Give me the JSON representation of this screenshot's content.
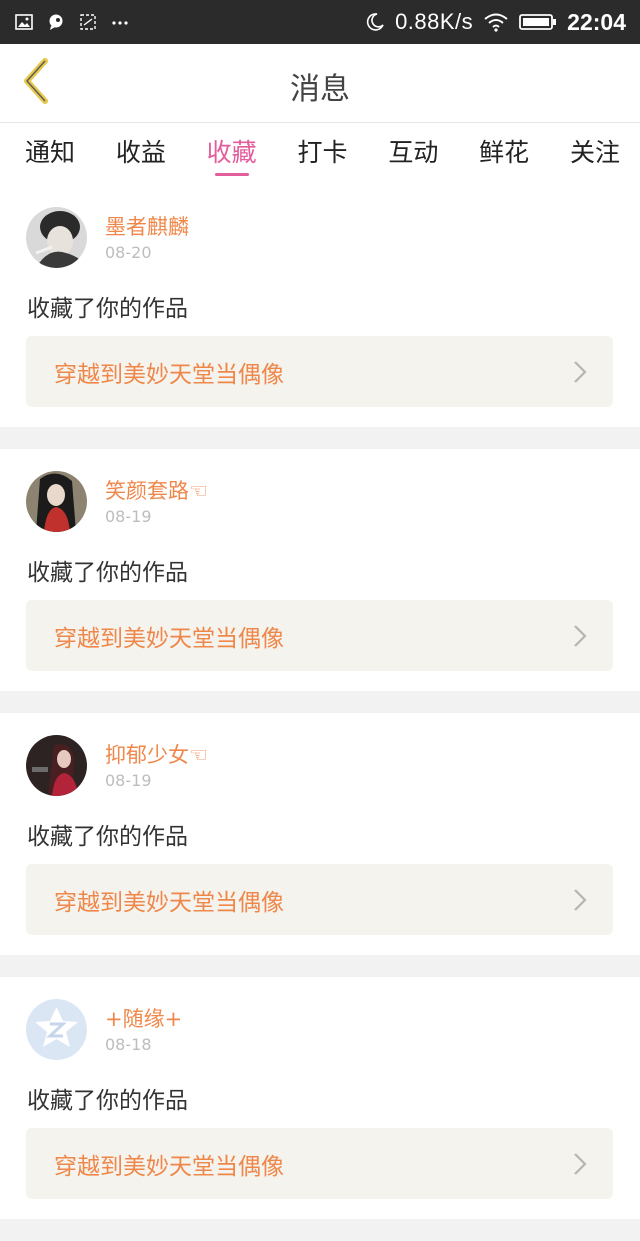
{
  "status_bar": {
    "network_speed": "0.88K/s",
    "time": "22:04",
    "left_icons": [
      "image-icon",
      "chat-bubble-icon",
      "screenshot-icon",
      "more-dots-icon"
    ],
    "right_icons": [
      "moon-icon",
      "wifi-icon",
      "battery-icon"
    ]
  },
  "header": {
    "title": "消息",
    "back_icon": "chevron-left-icon"
  },
  "tabs": [
    {
      "label": "通知"
    },
    {
      "label": "收益"
    },
    {
      "label": "收藏",
      "active": true
    },
    {
      "label": "打卡"
    },
    {
      "label": "互动"
    },
    {
      "label": "鲜花"
    },
    {
      "label": "关注"
    }
  ],
  "feed": [
    {
      "username": "墨者麒麟",
      "date": "08-20",
      "action": "收藏了你的作品",
      "work_title": "穿越到美妙天堂当偶像"
    },
    {
      "username": "笑颜套路☜",
      "date": "08-19",
      "action": "收藏了你的作品",
      "work_title": "穿越到美妙天堂当偶像"
    },
    {
      "username": "抑郁少女☜",
      "date": "08-19",
      "action": "收藏了你的作品",
      "work_title": "穿越到美妙天堂当偶像"
    },
    {
      "username": "+随缘+",
      "date": "08-18",
      "action": "收藏了你的作品",
      "work_title": "穿越到美妙天堂当偶像"
    }
  ],
  "colors": {
    "accent_pink": "#e35d9d",
    "username_orange": "#f0874a",
    "back_arrow_yellow": "#e6c84c"
  }
}
